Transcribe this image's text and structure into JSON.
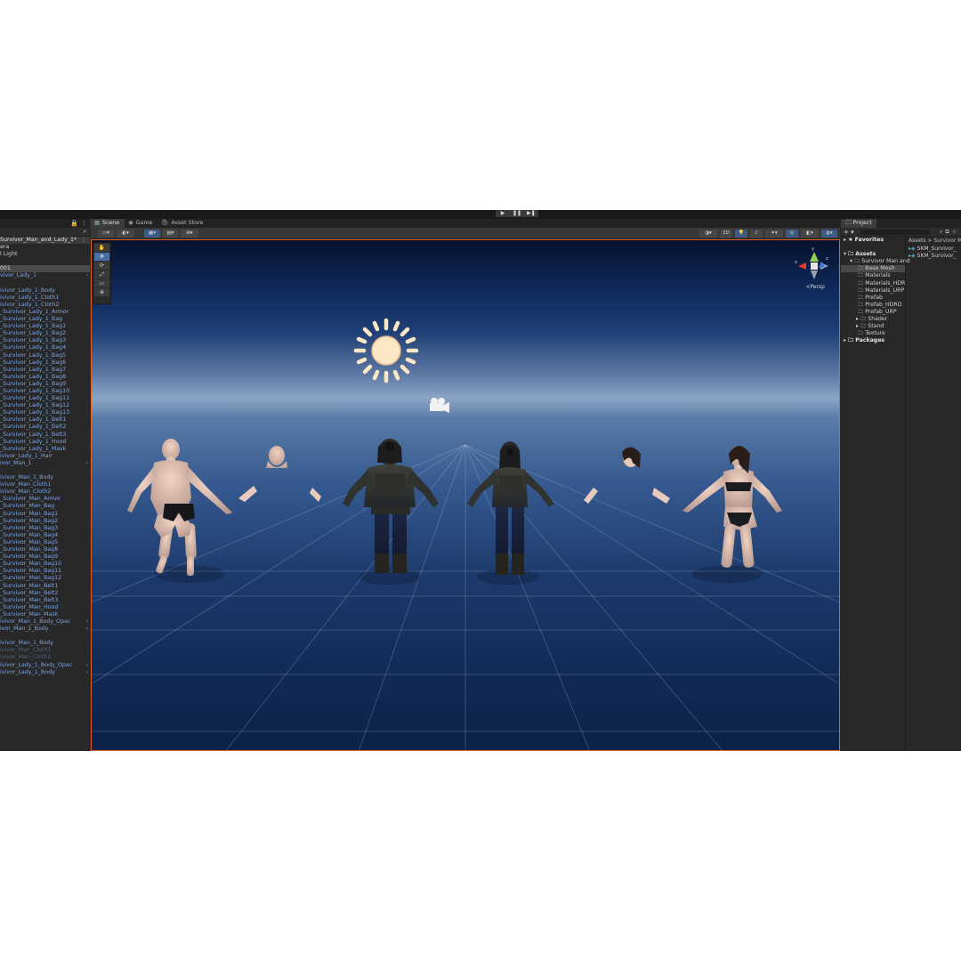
{
  "play_controls": [
    "▶",
    "❚❚",
    "▶❚"
  ],
  "hierarchy": {
    "scene_name": "Survivor_Man_and_Lady_1*",
    "items": [
      {
        "label": "era",
        "style": "normal"
      },
      {
        "label": "l Light",
        "style": "normal"
      },
      {
        "label": "",
        "style": "normal"
      },
      {
        "label": "001",
        "style": "selected"
      },
      {
        "label": "vivor_Lady_1",
        "style": "blue",
        "arrow": true
      },
      {
        "label": "",
        "style": "normal"
      },
      {
        "label": "ivivor_Lady_1_Body",
        "style": "blue"
      },
      {
        "label": "ivivor_Lady_1_Cloth1",
        "style": "blue"
      },
      {
        "label": "ivivor_Lady_1_Cloth2",
        "style": "blue"
      },
      {
        "label": "_Survivor_Lady_1_Armor",
        "style": "blue"
      },
      {
        "label": "_Survivor_Lady_1_Bag",
        "style": "blue"
      },
      {
        "label": "_Survivor_Lady_1_Bag1",
        "style": "blue"
      },
      {
        "label": "_Survivor_Lady_1_Bag2",
        "style": "blue"
      },
      {
        "label": "_Survivor_Lady_1_Bag3",
        "style": "blue"
      },
      {
        "label": "_Survivor_Lady_1_Bag4",
        "style": "blue"
      },
      {
        "label": "_Survivor_Lady_1_Bag5",
        "style": "blue"
      },
      {
        "label": "_Survivor_Lady_1_Bag6",
        "style": "blue"
      },
      {
        "label": "_Survivor_Lady_1_Bag7",
        "style": "blue"
      },
      {
        "label": "_Survivor_Lady_1_Bag8",
        "style": "blue"
      },
      {
        "label": "_Survivor_Lady_1_Bag9",
        "style": "blue"
      },
      {
        "label": "_Survivor_Lady_1_Bag10",
        "style": "blue"
      },
      {
        "label": "_Survivor_Lady_1_Bag11",
        "style": "blue"
      },
      {
        "label": "_Survivor_Lady_1_Bag12",
        "style": "blue"
      },
      {
        "label": "_Survivor_Lady_1_Bag13",
        "style": "blue"
      },
      {
        "label": "_Survivor_Lady_1_Belt1",
        "style": "blue"
      },
      {
        "label": "_Survivor_Lady_1_Belt2",
        "style": "blue"
      },
      {
        "label": "_Survivor_Lady_1_Belt3",
        "style": "blue"
      },
      {
        "label": "_Survivor_Lady_1_Hood",
        "style": "blue"
      },
      {
        "label": "_Survivor_Lady_1_Mask",
        "style": "blue"
      },
      {
        "label": "ivivor_Lady_1_Hair",
        "style": "blue"
      },
      {
        "label": "ivor_Man_1",
        "style": "blue",
        "arrow": true
      },
      {
        "label": "",
        "style": "normal"
      },
      {
        "label": "ivivor_Man_1_Body",
        "style": "blue"
      },
      {
        "label": "ivivor_Man_Cloth1",
        "style": "blue"
      },
      {
        "label": "ivivor_Man_Cloth2",
        "style": "blue"
      },
      {
        "label": "_Survivor_Man_Armor",
        "style": "blue"
      },
      {
        "label": "_Survivor_Man_Bag",
        "style": "blue"
      },
      {
        "label": "_Survivor_Man_Bag1",
        "style": "blue"
      },
      {
        "label": "_Survivor_Man_Bag2",
        "style": "blue"
      },
      {
        "label": "_Survivor_Man_Bag3",
        "style": "blue"
      },
      {
        "label": "_Survivor_Man_Bag4",
        "style": "blue"
      },
      {
        "label": "_Survivor_Man_Bag5",
        "style": "blue"
      },
      {
        "label": "_Survivor_Man_Bag8",
        "style": "blue"
      },
      {
        "label": "_Survivor_Man_Bag9",
        "style": "blue"
      },
      {
        "label": "_Survivor_Man_Bag10",
        "style": "blue"
      },
      {
        "label": "_Survivor_Man_Bag11",
        "style": "blue"
      },
      {
        "label": "_Survivor_Man_Bag12",
        "style": "blue"
      },
      {
        "label": "_Survivor_Man_Belt1",
        "style": "blue"
      },
      {
        "label": "_Survivor_Man_Belt2",
        "style": "blue"
      },
      {
        "label": "_Survivor_Man_Belt3",
        "style": "blue"
      },
      {
        "label": "_Survivor_Man_Hood",
        "style": "blue"
      },
      {
        "label": "_Survivor_Man_Mask",
        "style": "blue"
      },
      {
        "label": "ivivor_Man_1_Body_Opac",
        "style": "blue",
        "arrow": true
      },
      {
        "label": "ivor_Man_1_Body",
        "style": "blue",
        "arrow": true
      },
      {
        "label": "",
        "style": "normal"
      },
      {
        "label": "ivivor_Man_1_Body",
        "style": "blue"
      },
      {
        "label": "ivivor_Man_Cloth1",
        "style": "faded"
      },
      {
        "label": "ivivor_Man_Cloth2",
        "style": "faded"
      },
      {
        "label": "ivivor_Lady_1_Body_Opac",
        "style": "blue",
        "arrow": true
      },
      {
        "label": "ivivor_Lady_1_Body",
        "style": "blue",
        "arrow": true
      }
    ]
  },
  "scene": {
    "tabs": [
      {
        "label": "Scene",
        "icon": "scene-grid-icon",
        "active": true
      },
      {
        "label": "Game",
        "icon": "gamepad-icon",
        "active": false
      },
      {
        "label": "Asset Store",
        "icon": "shopping-bag-icon",
        "active": false
      }
    ],
    "toolbar_2d_label": "2D",
    "persp_label": "<Persp",
    "gizmo_axes": {
      "y": "y",
      "x": "x",
      "z": "z"
    },
    "tools": [
      "✋",
      "✥",
      "⟳",
      "⤢",
      "▭",
      "⊕"
    ]
  },
  "project": {
    "tab_label": "Project",
    "add_label": "+ ▾",
    "tree": [
      {
        "label": "Favorites",
        "fold": "▸",
        "icon": "★",
        "bold": true,
        "indent": 0
      },
      {
        "label": "",
        "fold": "",
        "icon": "",
        "bold": false,
        "indent": 0
      },
      {
        "label": "Assets",
        "fold": "▾",
        "icon": "🗀",
        "bold": true,
        "indent": 0
      },
      {
        "label": "Survivor Man and",
        "fold": "▾",
        "icon": "🗀",
        "bold": false,
        "indent": 1
      },
      {
        "label": "Base Mesh",
        "fold": "",
        "icon": "🗀",
        "bold": false,
        "indent": 2,
        "selected": true
      },
      {
        "label": "Materials",
        "fold": "",
        "icon": "🗀",
        "bold": false,
        "indent": 2
      },
      {
        "label": "Materials_HDR",
        "fold": "",
        "icon": "🗀",
        "bold": false,
        "indent": 2
      },
      {
        "label": "Materials_URP",
        "fold": "",
        "icon": "🗀",
        "bold": false,
        "indent": 2
      },
      {
        "label": "Prefab",
        "fold": "",
        "icon": "🗀",
        "bold": false,
        "indent": 2
      },
      {
        "label": "Prefab_HDRD",
        "fold": "",
        "icon": "🗀",
        "bold": false,
        "indent": 2
      },
      {
        "label": "Prefab_URP",
        "fold": "",
        "icon": "🗀",
        "bold": false,
        "indent": 2
      },
      {
        "label": "Shader",
        "fold": "▸",
        "icon": "🗀",
        "bold": false,
        "indent": 2
      },
      {
        "label": "Stand",
        "fold": "▸",
        "icon": "🗀",
        "bold": false,
        "indent": 2
      },
      {
        "label": "Texture",
        "fold": "",
        "icon": "🗀",
        "bold": false,
        "indent": 2
      },
      {
        "label": "Packages",
        "fold": "▸",
        "icon": "🗀",
        "bold": true,
        "indent": 0
      }
    ],
    "breadcrumb": "Assets > Survivor M",
    "assets": [
      "SKM_Survivor_",
      "SKM_Survivor_"
    ]
  },
  "colors": {
    "accent_orange": "#e0622a",
    "hierarchy_blue": "#7ba4e6",
    "sun": "#fbe6c6"
  }
}
